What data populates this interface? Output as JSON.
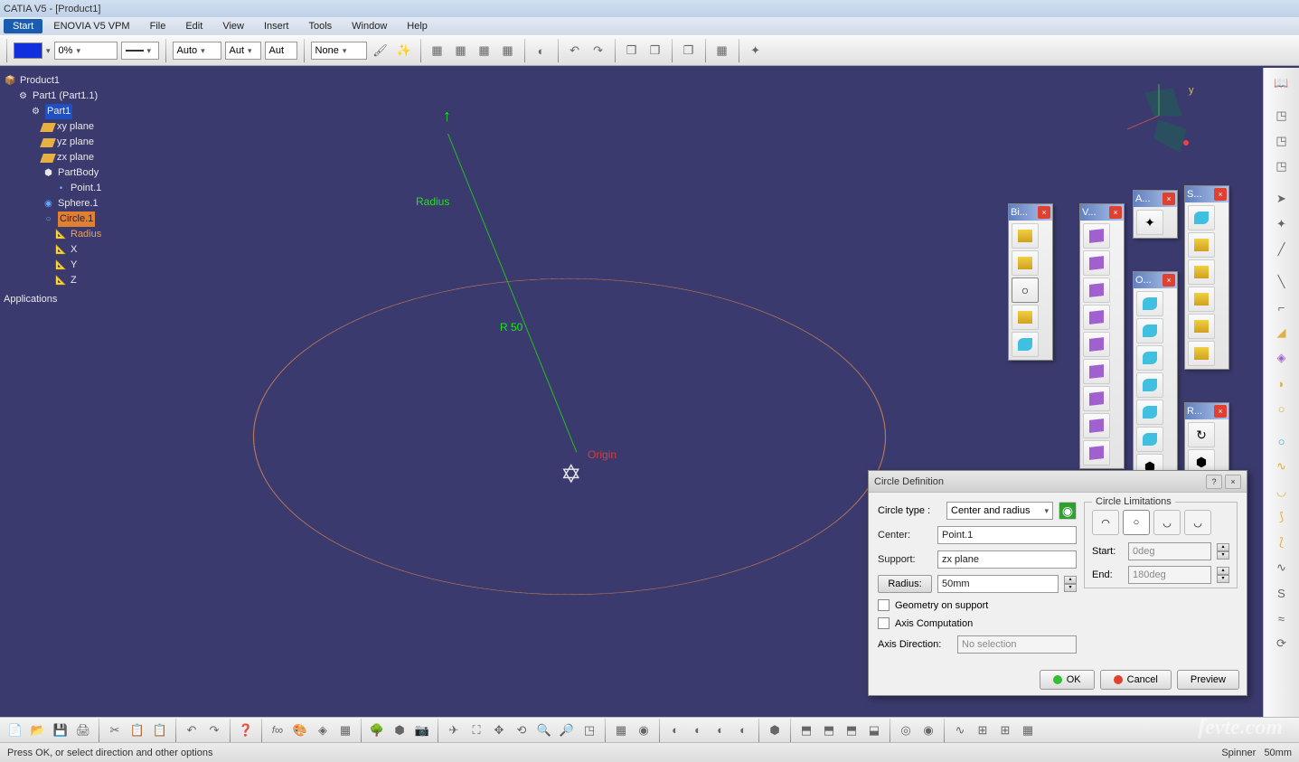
{
  "title": "CATIA V5 - [Product1]",
  "menu": {
    "start": "Start",
    "items": [
      "ENOVIA V5 VPM",
      "File",
      "Edit",
      "View",
      "Insert",
      "Tools",
      "Window",
      "Help"
    ]
  },
  "toolbar": {
    "percent": "0%",
    "auto1": "Auto",
    "auto2": "Aut",
    "auto3": "Aut",
    "none": "None"
  },
  "tree": {
    "root": "Product1",
    "part1_inst": "Part1 (Part1.1)",
    "part1": "Part1",
    "xy": "xy plane",
    "yz": "yz plane",
    "zx": "zx plane",
    "partbody": "PartBody",
    "point1": "Point.1",
    "sphere1": "Sphere.1",
    "circle1": "Circle.1",
    "radius": "Radius",
    "x": "X",
    "y": "Y",
    "z": "Z",
    "applications": "Applications"
  },
  "viewport_labels": {
    "radius": "Radius",
    "r50": "R 50",
    "origin": "Origin"
  },
  "float_toolbars": {
    "bi": "Bi...",
    "v": "V...",
    "a": "A...",
    "o": "O...",
    "s": "S...",
    "r": "R..."
  },
  "dialog": {
    "title": "Circle Definition",
    "circle_type_label": "Circle type :",
    "circle_type_value": "Center and radius",
    "center_label": "Center:",
    "center_value": "Point.1",
    "support_label": "Support:",
    "support_value": "zx plane",
    "radius_label": "Radius:",
    "radius_value": "50mm",
    "geom_on_support": "Geometry on support",
    "axis_computation": "Axis Computation",
    "axis_direction_label": "Axis Direction:",
    "axis_direction_value": "No selection",
    "limitations_legend": "Circle Limitations",
    "start_label": "Start:",
    "start_value": "0deg",
    "end_label": "End:",
    "end_value": "180deg",
    "ok": "OK",
    "cancel": "Cancel",
    "preview": "Preview"
  },
  "status": {
    "message": "Press OK, or select direction and other options",
    "spinner_label": "Spinner",
    "spinner_value": "50mm"
  },
  "watermark": "fevte.com"
}
